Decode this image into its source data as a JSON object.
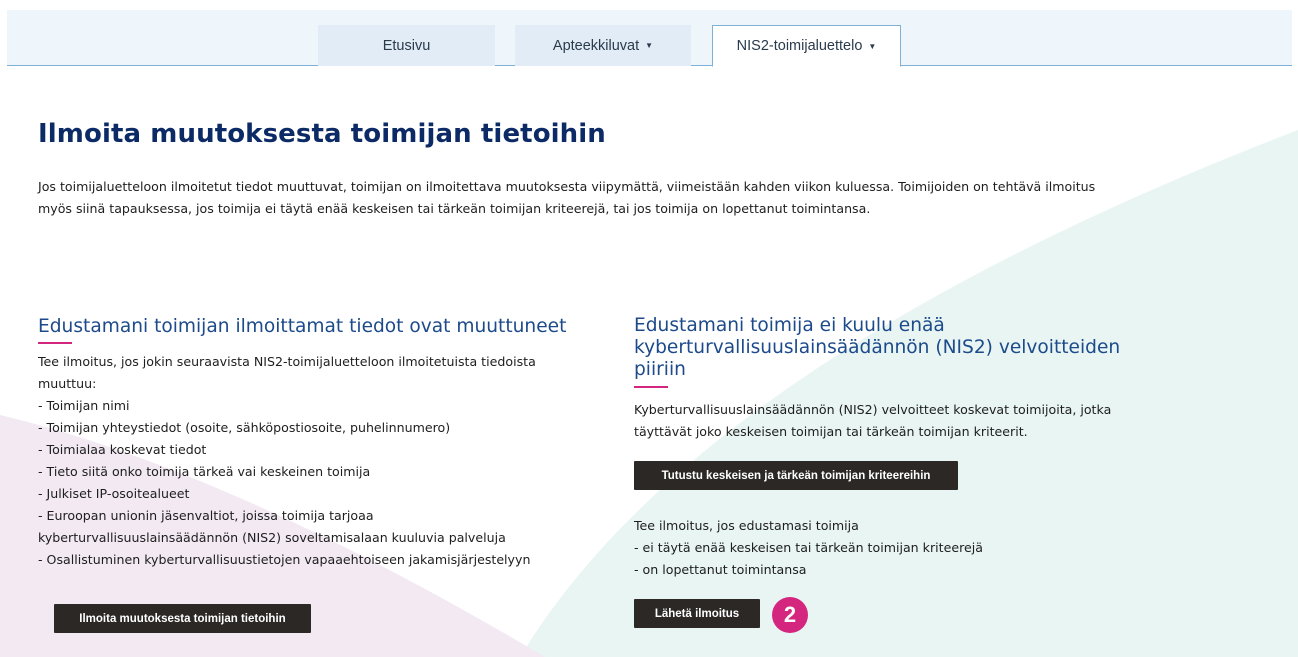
{
  "nav": {
    "tabs": [
      {
        "label": "Etusivu",
        "has_dropdown": false,
        "active": false
      },
      {
        "label": "Apteekkiluvat",
        "has_dropdown": true,
        "active": false
      },
      {
        "label": "NIS2-toimijaluettelo",
        "has_dropdown": true,
        "active": true
      }
    ],
    "caret_glyph": "▼"
  },
  "page": {
    "title": "Ilmoita muutoksesta toimijan tietoihin",
    "intro_line1": "Jos toimijaluetteloon ilmoitetut tiedot muuttuvat, toimijan on ilmoitettava muutoksesta viipymättä, viimeistään kahden viikon kuluessa. Toimijoiden on tehtävä ilmoitus",
    "intro_line2": "myös siinä tapauksessa, jos toimija ei täytä enää keskeisen tai tärkeän toimijan kriteerejä, tai jos toimija on lopettanut toimintansa."
  },
  "left": {
    "heading": "Edustamani toimijan ilmoittamat tiedot ovat muuttuneet",
    "lines": [
      "Tee ilmoitus, jos jokin seuraavista NIS2-toimijaluetteloon ilmoitetuista tiedoista",
      "muuttuu:",
      "- Toimijan nimi",
      "- Toimijan yhteystiedot (osoite, sähköpostiosoite, puhelinnumero)",
      "- Toimialaa koskevat tiedot",
      "- Tieto siitä onko toimija tärkeä vai keskeinen toimija",
      "- Julkiset IP-osoitealueet",
      "- Euroopan unionin jäsenvaltiot, joissa toimija tarjoaa",
      "kyberturvallisuuslainsäädännön (NIS2) soveltamisalaan kuuluvia palveluja",
      "- Osallistuminen kyberturvallisuustietojen vapaaehtoiseen jakamisjärjestelyyn"
    ],
    "button_label": "Ilmoita muutoksesta toimijan tietoihin"
  },
  "right": {
    "heading_lines": [
      "Edustamani toimija ei kuulu enää",
      "kyberturvallisuuslainsäädännön (NIS2) velvoitteiden",
      "piiriin"
    ],
    "desc_lines": [
      "Kyberturvallisuuslainsäädännön (NIS2) velvoitteet koskevat toimijoita, jotka",
      "täyttävät joko keskeisen toimijan tai tärkeän toimijan kriteerit."
    ],
    "criteria_button_label": "Tutustu keskeisen ja tärkeän toimijan kriteereihin",
    "notice_lines": [
      "Tee ilmoitus, jos edustamasi toimija",
      "- ei täytä enää keskeisen tai tärkeän toimijan kriteerejä",
      "- on lopettanut toimintansa"
    ],
    "send_button_label": "Lähetä ilmoitus",
    "step_badge": "2"
  },
  "colors": {
    "title": "#0c2a66",
    "heading": "#1c4a8a",
    "accent_underline": "#d3277f",
    "button_bg": "#2b2826",
    "badge_bg": "#d4267e",
    "nav_bg": "#eef5fb",
    "tab_bg": "#e1ecf6",
    "nav_border": "#7fb0d6",
    "bg_shape_mint": "#e9f5f2",
    "bg_shape_lilac": "#f1e8f0"
  }
}
